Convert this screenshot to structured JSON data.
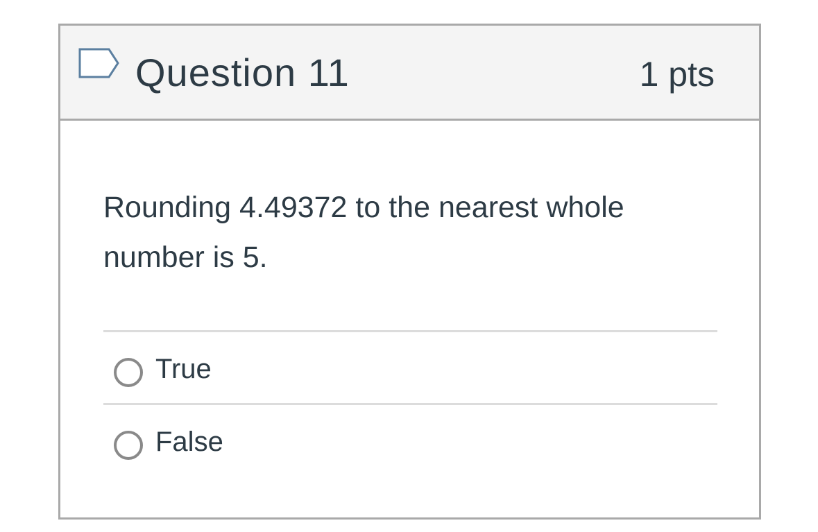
{
  "question": {
    "title": "Question 11",
    "points": "1 pts",
    "flag_icon": "bookmark-flag-icon",
    "text": "Rounding 4.49372 to the nearest whole number is 5.",
    "answers": [
      {
        "label": "True",
        "selected": false
      },
      {
        "label": "False",
        "selected": false
      }
    ]
  },
  "colors": {
    "header_background": "#f4f4f4",
    "border": "#a9a9a9",
    "divider": "#dcdcdc",
    "text": "#2d3b45",
    "flag_stroke": "#5b7fa0",
    "radio_border": "#8a8a8a"
  }
}
